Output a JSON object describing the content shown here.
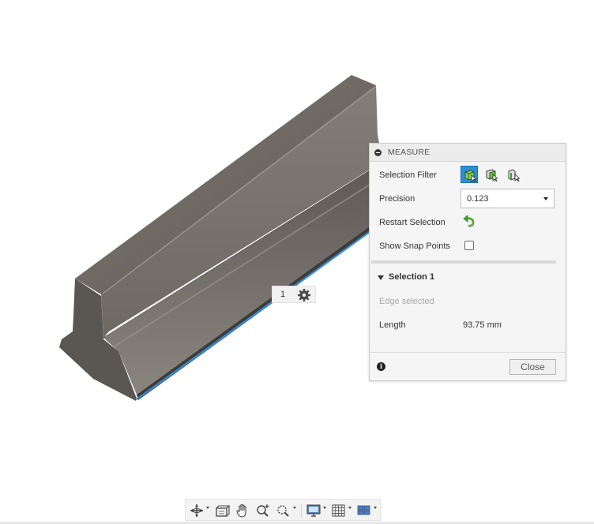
{
  "viewport": {
    "model": "extruded-profile-body",
    "body_color": "#6f6a64",
    "highlight_edge_color": "#2f8fe0",
    "selection_tag": {
      "count": "1",
      "icon": "gear-icon"
    }
  },
  "measure_panel": {
    "title": "MEASURE",
    "selection_filter": {
      "label": "Selection Filter",
      "options": [
        {
          "icon": "select-body-filter-icon",
          "active": true
        },
        {
          "icon": "select-face-filter-icon",
          "active": false
        },
        {
          "icon": "select-edge-filter-icon",
          "active": false
        }
      ]
    },
    "precision": {
      "label": "Precision",
      "value": "0.123"
    },
    "restart_selection": {
      "label": "Restart Selection",
      "icon": "restart-arrow-icon"
    },
    "show_snap_points": {
      "label": "Show Snap Points",
      "checked": false
    },
    "selection_section": {
      "title": "Selection 1",
      "status": "Edge selected",
      "length_label": "Length",
      "length_value": "93.75 mm"
    },
    "close_label": "Close",
    "accent_color": "#2d8fd6"
  },
  "bottom_toolbar": {
    "items": [
      "orbit-icon",
      "look-at-icon",
      "pan-icon",
      "zoom-icon",
      "zoom-window-icon",
      "display-settings-icon",
      "grid-settings-icon",
      "viewports-icon"
    ]
  }
}
